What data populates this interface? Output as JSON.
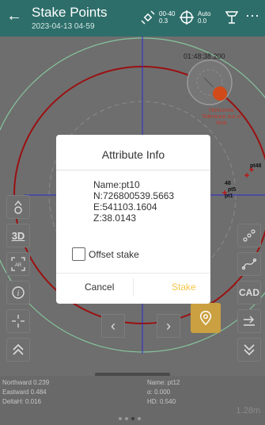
{
  "header": {
    "title": "Stake Points",
    "subtitle": "2023-04-13 04-59",
    "sat_top": "00-40",
    "sat_bottom": "0.3",
    "diff_top": "Auto",
    "diff_bottom": "0.0",
    "more_icon": "more-icon"
  },
  "map": {
    "time_readout": "01:48:38.200",
    "tolerance_note": "Horizontal Tolerance out of limit",
    "point_labels": [
      "pt48",
      "48",
      "pt5",
      "pt1"
    ],
    "accent_red": "#c0392b",
    "accent_blue": "#2a2ad0"
  },
  "dialog": {
    "title": "Attribute Info",
    "name": "Name:pt10",
    "n": "N:726800539.5663",
    "e": "E:541103.1604",
    "z": "Z:38.0143",
    "offset_label": "Offset stake",
    "cancel": "Cancel",
    "stake": "Stake"
  },
  "tools": {
    "left": [
      "walk-icon",
      "3D",
      "ar-icon",
      "info-icon",
      "crosshair-icon",
      "chevrons-up-icon"
    ],
    "right": [
      "points-icon",
      "curve-icon",
      "CAD",
      "arrow-icon",
      "chevrons-down-icon"
    ]
  },
  "bottom": {
    "northward": "Northward 0.239",
    "eastward": "Eastward 0.484",
    "deltah": "DeltaH: 0.016",
    "name": "Name: pt12",
    "alpha": "α: 0.000",
    "hd": "HD: 0.540",
    "scale": "1.28m"
  }
}
